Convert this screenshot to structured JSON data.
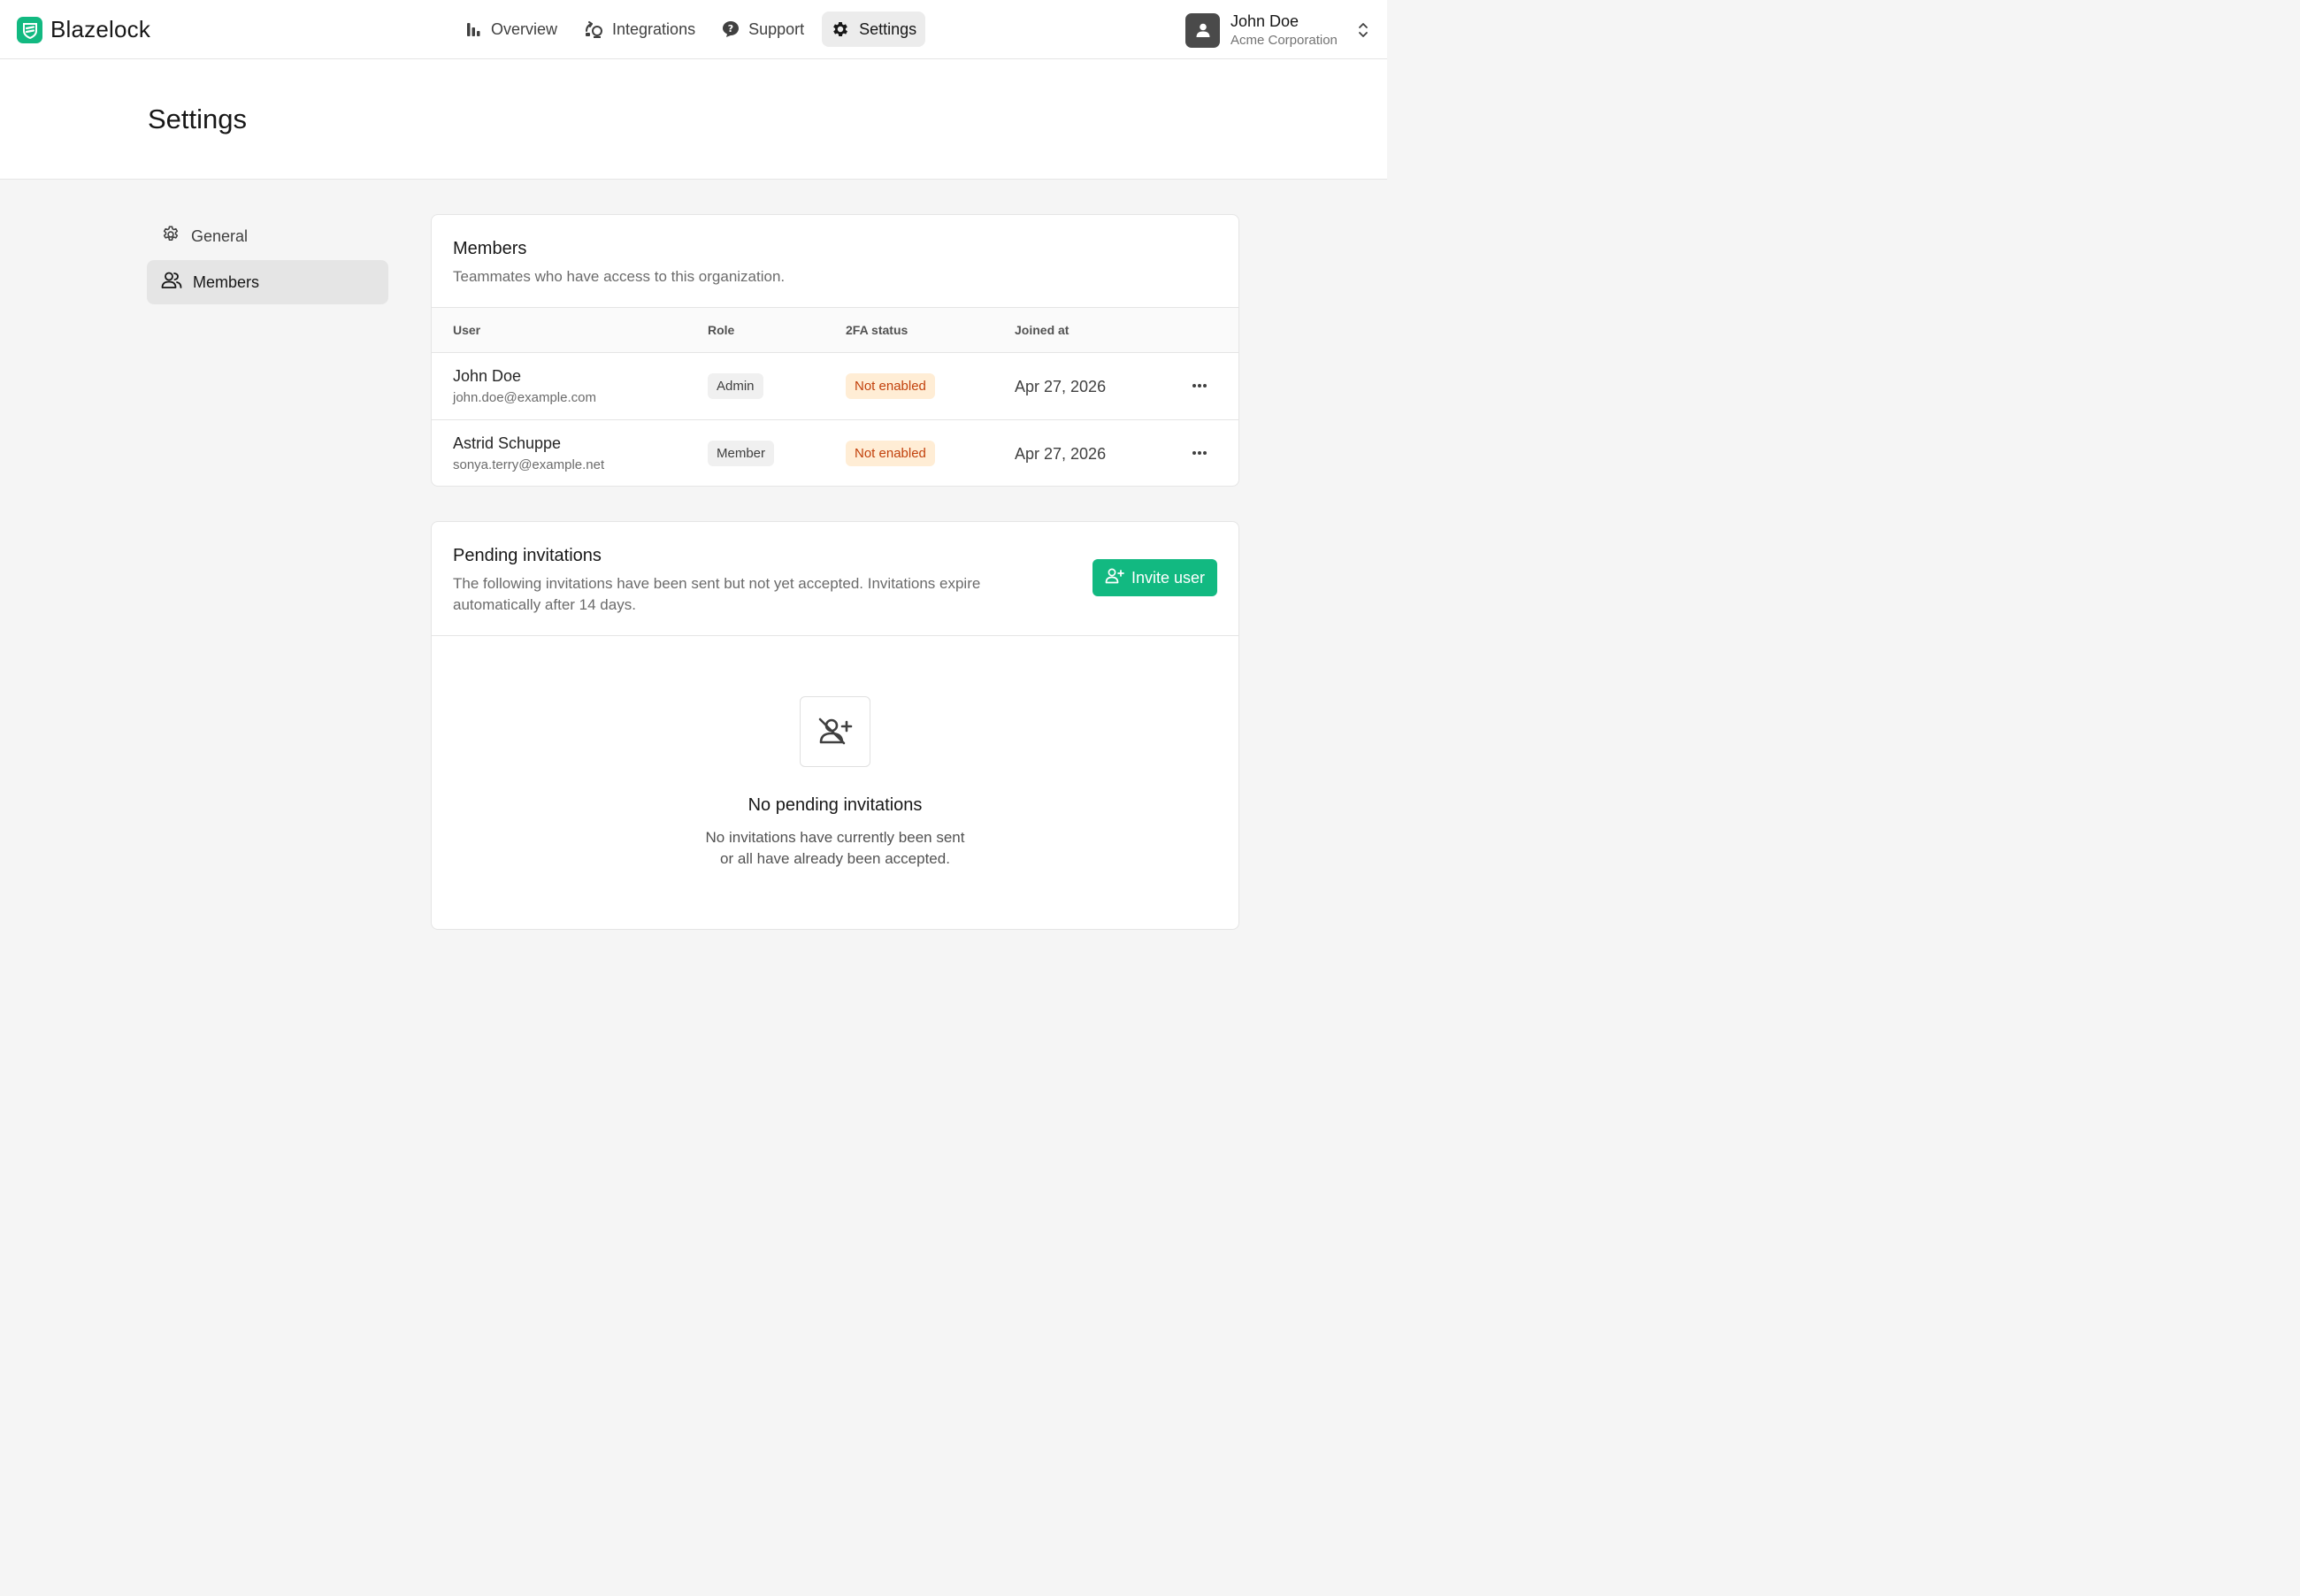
{
  "app": {
    "name": "Blazelock"
  },
  "nav": {
    "items": [
      {
        "label": "Overview",
        "icon": "bar-chart-icon"
      },
      {
        "label": "Integrations",
        "icon": "integrations-icon"
      },
      {
        "label": "Support",
        "icon": "help-icon"
      },
      {
        "label": "Settings",
        "icon": "gear-icon",
        "active": true
      }
    ]
  },
  "account": {
    "name": "John Doe",
    "org": "Acme Corporation"
  },
  "page": {
    "title": "Settings"
  },
  "sidebar": {
    "items": [
      {
        "label": "General",
        "icon": "gear-outline-icon"
      },
      {
        "label": "Members",
        "icon": "users-icon",
        "active": true
      }
    ]
  },
  "members": {
    "title": "Members",
    "description": "Teammates who have access to this organization.",
    "columns": [
      "User",
      "Role",
      "2FA status",
      "Joined at"
    ],
    "rows": [
      {
        "name": "John Doe",
        "email": "john.doe@example.com",
        "role": "Admin",
        "twofa": "Not enabled",
        "joined": "Apr 27, 2026"
      },
      {
        "name": "Astrid Schuppe",
        "email": "sonya.terry@example.net",
        "role": "Member",
        "twofa": "Not enabled",
        "joined": "Apr 27, 2026"
      }
    ]
  },
  "pending": {
    "title": "Pending invitations",
    "description": "The following invitations have been sent but not yet accepted. Invitations expire automatically after 14 days.",
    "invite_label": "Invite user",
    "empty_title": "No pending invitations",
    "empty_line1": "No invitations have currently been sent",
    "empty_line2": "or all have already been accepted."
  },
  "colors": {
    "brand": "#12b981",
    "warning_bg": "#ffedd5",
    "warning_text": "#c2410c"
  }
}
